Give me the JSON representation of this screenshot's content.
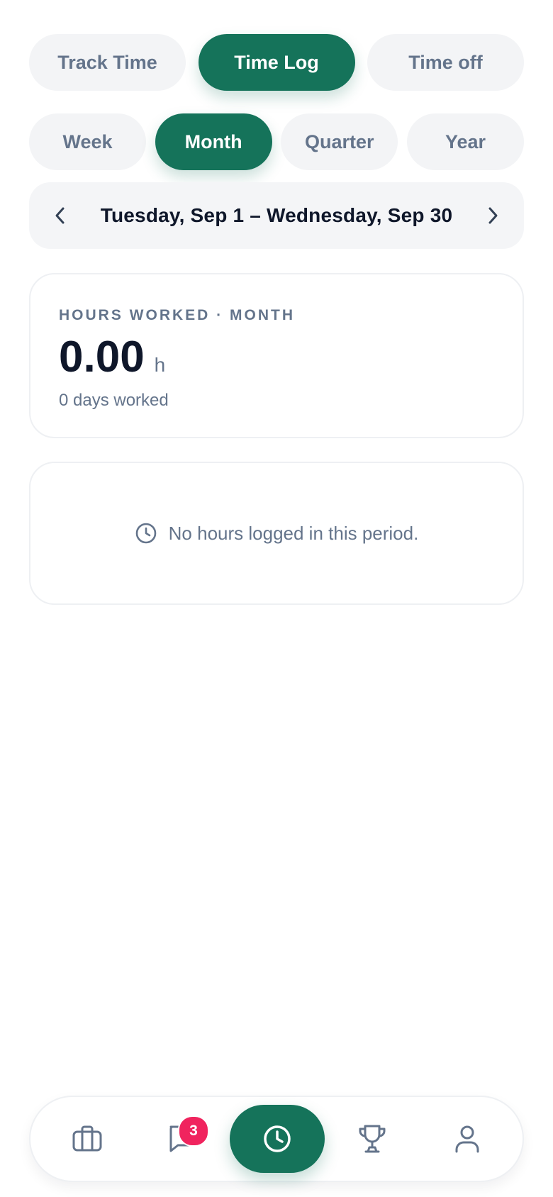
{
  "top_tabs": [
    {
      "label": "Track Time",
      "active": false
    },
    {
      "label": "Time Log",
      "active": true
    },
    {
      "label": "Time off",
      "active": false
    }
  ],
  "period_tabs": [
    {
      "label": "Week",
      "active": false
    },
    {
      "label": "Month",
      "active": true
    },
    {
      "label": "Quarter",
      "active": false
    },
    {
      "label": "Year",
      "active": false
    }
  ],
  "date_range": {
    "label": "Tuesday, Sep 1 – Wednesday, Sep 30",
    "prev_icon": "chevron-left-icon",
    "next_icon": "chevron-right-icon"
  },
  "summary": {
    "label": "HOURS WORKED · MONTH",
    "hours": "0.00",
    "unit": "h",
    "days_worked": "0 days worked"
  },
  "empty_state": {
    "icon": "clock-icon",
    "text": "No hours logged in this period."
  },
  "bottom_nav": {
    "items": [
      {
        "icon": "briefcase-icon"
      },
      {
        "icon": "chat-icon",
        "badge": "3"
      },
      {
        "icon": "clock-icon",
        "active": true
      },
      {
        "icon": "trophy-icon"
      },
      {
        "icon": "user-icon"
      }
    ]
  },
  "colors": {
    "accent": "#15735a",
    "pill_bg": "#f3f4f6",
    "muted_text": "#64748b",
    "badge": "#f0245e"
  }
}
